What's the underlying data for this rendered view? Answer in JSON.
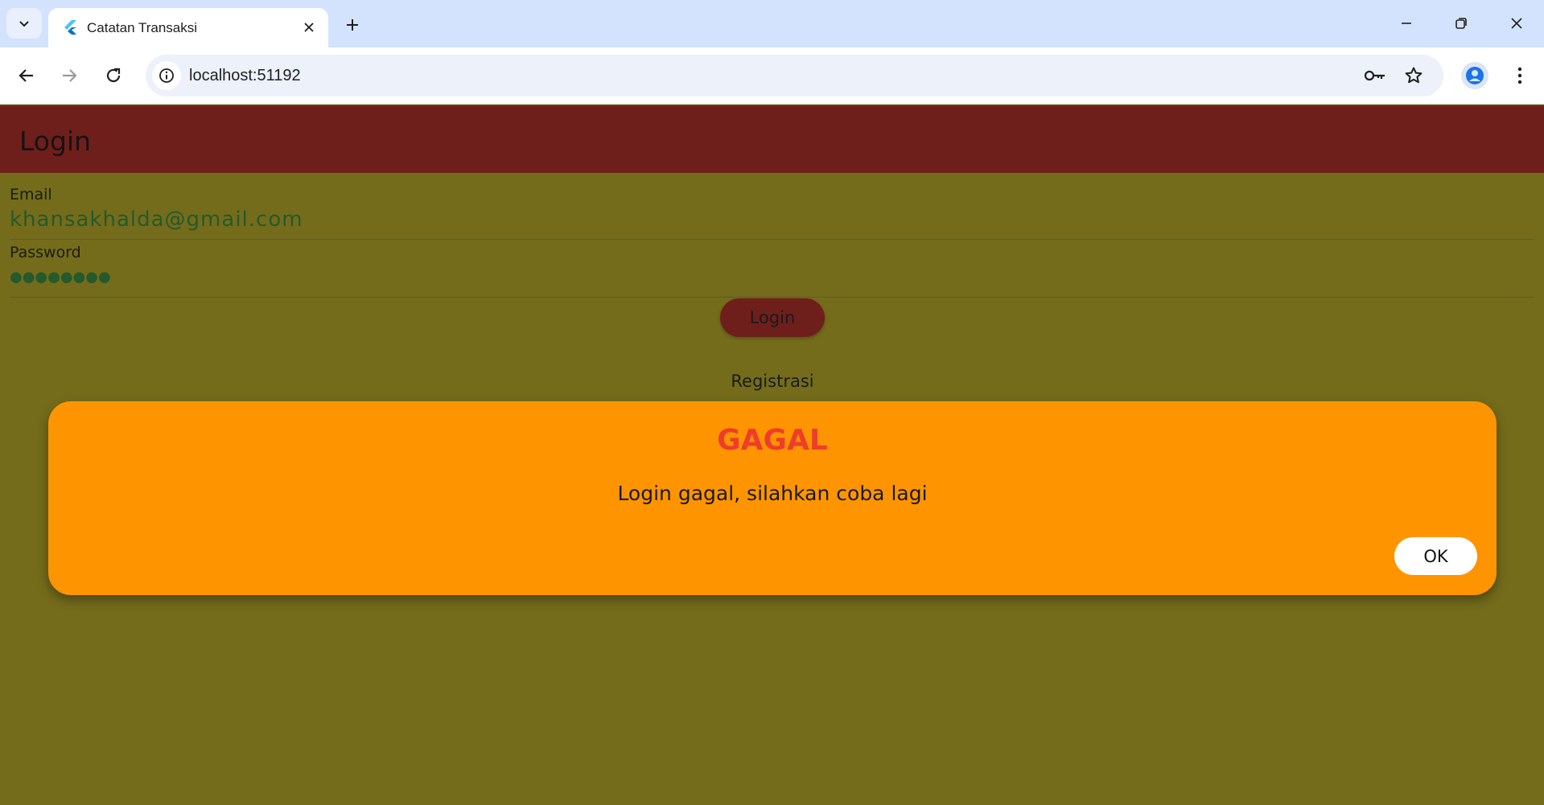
{
  "browser": {
    "tab_title": "Catatan Transaksi",
    "url": "localhost:51192",
    "icons": {
      "tab_search": "chevron-down-icon",
      "favicon": "flutter-icon",
      "tab_close": "close-icon",
      "new_tab": "plus-icon",
      "minimize": "minimize-icon",
      "restore": "restore-icon",
      "close_window": "close-icon",
      "back": "arrow-left-icon",
      "forward": "arrow-right-icon",
      "reload": "reload-icon",
      "site_info": "info-icon",
      "passwords": "key-icon",
      "bookmark": "star-icon",
      "profile": "person-icon",
      "menu": "kebab-menu-icon"
    }
  },
  "app": {
    "appbar_title": "Login",
    "email": {
      "label": "Email",
      "value": "khansakhalda@gmail.com"
    },
    "password": {
      "label": "Password",
      "value": "●●●●●●●●"
    },
    "login_button": "Login",
    "register_link": "Registrasi",
    "colors": {
      "appbar": "#6f1f1b",
      "background": "#746c1b",
      "input_text": "#245a2c"
    }
  },
  "dialog": {
    "title": "GAGAL",
    "message": "Login gagal, silahkan coba lagi",
    "ok_button": "OK",
    "colors": {
      "background": "#fe9500",
      "title": "#f03c2c"
    }
  }
}
